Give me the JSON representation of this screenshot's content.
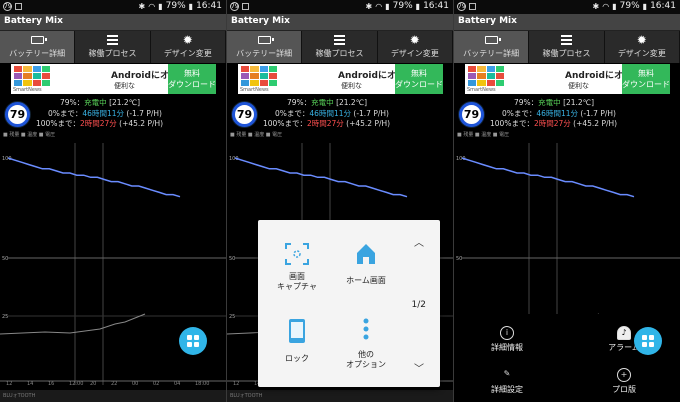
{
  "status": {
    "badge": "79",
    "battery": "79%",
    "time": "16:41"
  },
  "app_title": "Battery Mix",
  "tabs": [
    {
      "label": "バッテリー詳細",
      "icon": "battery-icon"
    },
    {
      "label": "稼働プロセス",
      "icon": "list-icon"
    },
    {
      "label": "デザイン変更",
      "icon": "gear-icon"
    }
  ],
  "ad": {
    "title": "Androidにオ",
    "subtitle": "便利な",
    "button_line1": "無料",
    "button_line2": "ダウンロード",
    "brand": "SmartNews"
  },
  "battery": {
    "level": "79",
    "line1_prefix": "79%：",
    "line1_status": "充電中",
    "line1_temp": "[21.2℃]",
    "line2_prefix": "0%まで：",
    "line2_value": "46時間11分",
    "line2_rate": "(-1.7 P/H)",
    "line3_prefix": "100%まで：",
    "line3_value": "2時間27分",
    "line3_rate": "(+45.2 P/H)"
  },
  "chart_legend": "■ 残量 ■ 温度 ■ 電圧",
  "axis": {
    "y_top": "100",
    "y_mid": "50",
    "y_low": "25",
    "y_bottom": "0"
  },
  "x_ticks": [
    "12",
    "14",
    "16",
    "12:00",
    "20",
    "22",
    "00",
    "02",
    "04",
    "18:00"
  ],
  "bottom_label": "BLUォTOOTH",
  "popup": {
    "capture_label_1": "画面",
    "capture_label_2": "キャプチャ",
    "home_label": "ホーム画面",
    "lock_label": "ロック",
    "other_label_1": "他の",
    "other_label_2": "オプション",
    "page": "1/2"
  },
  "menu": {
    "detail_label": "詳細情報",
    "alarm_label": "アラーム",
    "settings_label": "詳細設定",
    "pro_label": "プロ版"
  },
  "colors": {
    "accent": "#30b5e8",
    "ad_button": "#33b85a",
    "line": "#6a8cff",
    "ring": "#1e54d8"
  },
  "chart_data": {
    "type": "line",
    "ylim": [
      0,
      100
    ],
    "series": [
      {
        "values": [
          100,
          99,
          98,
          97,
          96,
          95,
          95,
          94,
          93,
          93,
          92,
          92,
          91,
          91,
          90,
          89,
          89,
          88,
          87,
          87,
          86,
          85,
          84,
          83,
          83,
          82
        ]
      }
    ]
  }
}
